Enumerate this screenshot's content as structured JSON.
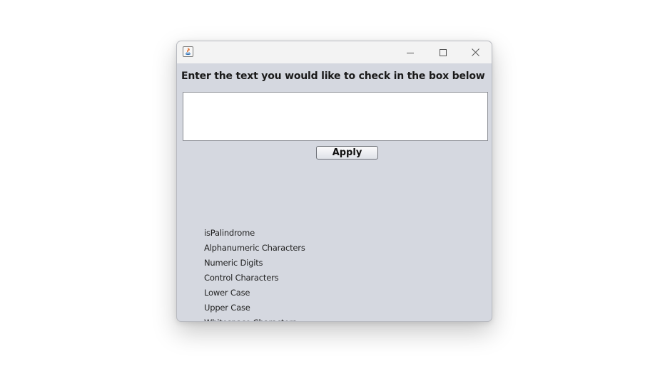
{
  "window": {
    "title": "",
    "controls": {
      "minimize_icon": "minimize-icon",
      "maximize_icon": "maximize-icon",
      "close_icon": "close-icon"
    }
  },
  "main": {
    "prompt": "Enter the text you would like to check in the box below",
    "input_value": "",
    "apply_label": "Apply",
    "checks": [
      "isPalindrome",
      "Alphanumeric Characters",
      "Numeric Digits",
      "Control Characters",
      "Lower Case",
      "Upper Case",
      "Whitespace Characters"
    ]
  },
  "colors": {
    "window_background": "#d5d8e0",
    "titlebar_background": "#f3f3f3"
  }
}
